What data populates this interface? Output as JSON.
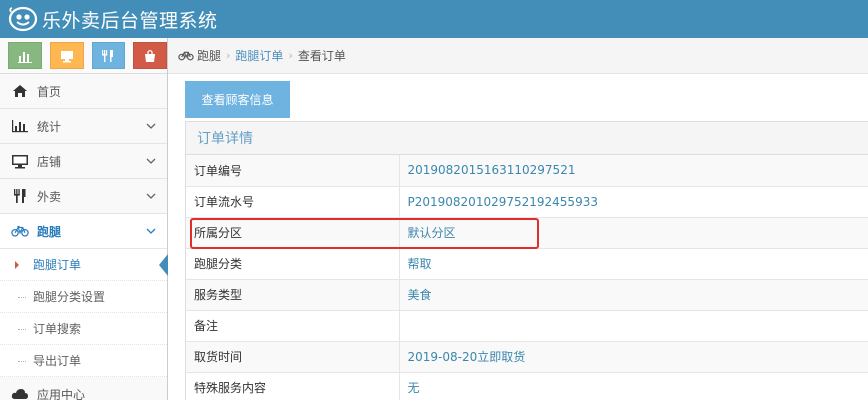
{
  "app": {
    "title": "乐外卖后台管理系统"
  },
  "colors": {
    "topbar": "#438eb9",
    "accent": "#2b7dbc",
    "highlight": "#e02d2d"
  },
  "shortcuts": [
    {
      "icon": "bar-chart-icon"
    },
    {
      "icon": "monitor-icon"
    },
    {
      "icon": "fork-knife-icon"
    },
    {
      "icon": "shopping-bag-icon"
    }
  ],
  "sidebar": {
    "items": [
      {
        "label": "首页",
        "icon": "home-icon"
      },
      {
        "label": "统计",
        "icon": "bar-chart-icon"
      },
      {
        "label": "店铺",
        "icon": "monitor-icon"
      },
      {
        "label": "外卖",
        "icon": "fork-knife-icon"
      },
      {
        "label": "跑腿",
        "icon": "bicycle-icon"
      }
    ],
    "subitems": [
      {
        "label": "跑腿订单"
      },
      {
        "label": "跑腿分类设置"
      },
      {
        "label": "订单搜索"
      },
      {
        "label": "导出订单"
      }
    ],
    "more": {
      "label": "应用中心",
      "icon": "cloud-icon"
    }
  },
  "breadcrumb": {
    "root": "跑腿",
    "parent": "跑腿订单",
    "current": "查看订单"
  },
  "main": {
    "view_customer_button": "查看顾客信息",
    "panel_title": "订单详情",
    "rows": [
      {
        "key": "订单编号",
        "value": "20190820151631102975​21"
      },
      {
        "key": "订单流水号",
        "value": "P20190820102975219245​5933"
      },
      {
        "key": "所属分区",
        "value": "默认分区"
      },
      {
        "key": "跑腿分类",
        "value": "帮取"
      },
      {
        "key": "服务类型",
        "value": "美食"
      },
      {
        "key": "备注",
        "value": ""
      },
      {
        "key": "取货时间",
        "value": "2019-08-20立即取货"
      },
      {
        "key": "特殊服务内容",
        "value": "无"
      }
    ]
  }
}
